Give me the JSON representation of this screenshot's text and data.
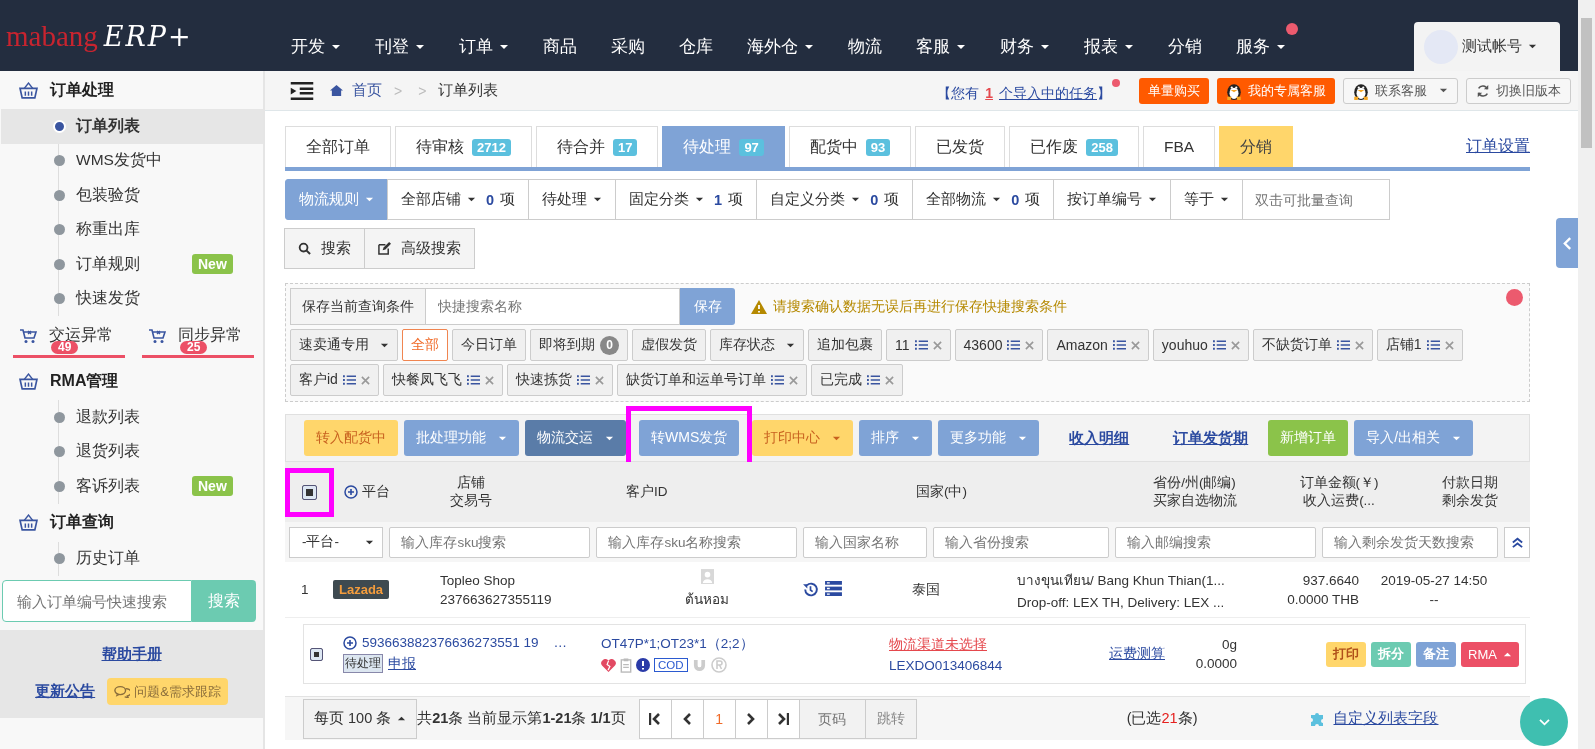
{
  "logo": {
    "brand": "mabang",
    "product": "ERP+"
  },
  "nav": [
    {
      "label": "开发",
      "dropdown": true,
      "dot": false
    },
    {
      "label": "刊登",
      "dropdown": true,
      "dot": false
    },
    {
      "label": "订单",
      "dropdown": true,
      "dot": false
    },
    {
      "label": "商品",
      "dropdown": false,
      "dot": false
    },
    {
      "label": "采购",
      "dropdown": false,
      "dot": false
    },
    {
      "label": "仓库",
      "dropdown": false,
      "dot": false
    },
    {
      "label": "海外仓",
      "dropdown": true,
      "dot": false
    },
    {
      "label": "物流",
      "dropdown": false,
      "dot": false
    },
    {
      "label": "客服",
      "dropdown": true,
      "dot": false
    },
    {
      "label": "财务",
      "dropdown": true,
      "dot": false
    },
    {
      "label": "报表",
      "dropdown": true,
      "dot": false
    },
    {
      "label": "分销",
      "dropdown": false,
      "dot": false
    },
    {
      "label": "服务",
      "dropdown": true,
      "dot": true
    }
  ],
  "account": {
    "name": "测试帐号"
  },
  "sidebar": {
    "sections": [
      {
        "title": "订单处理",
        "items": [
          {
            "label": "订单列表",
            "selected": true
          },
          {
            "label": "WMS发货中",
            "selected": false
          },
          {
            "label": "包装验货",
            "selected": false
          },
          {
            "label": "称重出库",
            "selected": false
          },
          {
            "label": "订单规则",
            "selected": false,
            "badge": "New"
          },
          {
            "label": "快速发货",
            "selected": false
          }
        ],
        "exceptions": [
          {
            "label": "交运异常",
            "count": "49"
          },
          {
            "label": "同步异常",
            "count": "25"
          }
        ]
      },
      {
        "title": "RMA管理",
        "items": [
          {
            "label": "退款列表",
            "selected": false
          },
          {
            "label": "退货列表",
            "selected": false
          },
          {
            "label": "客诉列表",
            "selected": false,
            "badge": "New"
          }
        ]
      },
      {
        "title": "订单查询",
        "items": [
          {
            "label": "历史订单",
            "selected": false
          }
        ]
      }
    ],
    "quick_search": {
      "placeholder": "输入订单编号快速搜索",
      "button": "搜索"
    },
    "help_link": "帮助手册",
    "update_link": "更新公告",
    "feedback_button": "问题&需求跟踪"
  },
  "breadcrumb": {
    "home": "首页",
    "separators": [
      ">",
      ">"
    ],
    "current": "订单列表"
  },
  "notice": {
    "prefix": "【您有",
    "count": "1",
    "link": "个导入中的任务",
    "suffix": "】",
    "dot": true
  },
  "header_buttons": [
    {
      "label": "单量购买",
      "kind": "orange"
    },
    {
      "label": "我的专属客服",
      "kind": "orange-penguin"
    },
    {
      "label": "联系客服",
      "kind": "penguin-dropdown"
    },
    {
      "label": "切换旧版本",
      "kind": "refresh"
    }
  ],
  "tabs": [
    {
      "label": "全部订单",
      "selected": false,
      "kind": "normal"
    },
    {
      "label": "待审核",
      "count": "2712",
      "selected": false,
      "kind": "normal"
    },
    {
      "label": "待合并",
      "count": "17",
      "selected": false,
      "kind": "normal"
    },
    {
      "label": "待处理",
      "count": "97",
      "selected": true,
      "kind": "normal"
    },
    {
      "label": "配货中",
      "count": "93",
      "selected": false,
      "kind": "normal"
    },
    {
      "label": "已发货",
      "selected": false,
      "kind": "normal"
    },
    {
      "label": "已作废",
      "count": "258",
      "selected": false,
      "kind": "normal"
    },
    {
      "label": "FBA",
      "selected": false,
      "kind": "normal"
    },
    {
      "label": "分销",
      "selected": false,
      "kind": "highlight"
    }
  ],
  "order_settings_link": "订单设置",
  "filters": [
    {
      "label": "物流规则",
      "kind": "primary"
    },
    {
      "label": "全部店铺",
      "count": "0",
      "unit": "项",
      "kind": "dropdown"
    },
    {
      "label": "待处理",
      "kind": "dropdown"
    },
    {
      "label": "固定分类",
      "count": "1",
      "unit": "项",
      "kind": "dropdown"
    },
    {
      "label": "自定义分类",
      "count": "0",
      "unit": "项",
      "kind": "dropdown"
    },
    {
      "label": "全部物流",
      "count": "0",
      "unit": "项",
      "kind": "dropdown"
    },
    {
      "label": "按订单编号",
      "kind": "dropdown"
    },
    {
      "label": "等于",
      "kind": "dropdown"
    },
    {
      "placeholder": "双击可批量查询",
      "kind": "input"
    }
  ],
  "search_buttons": [
    {
      "label": "搜索",
      "kind": "search"
    },
    {
      "label": "高级搜索",
      "kind": "edit"
    }
  ],
  "saved_search": {
    "label": "保存当前查询条件",
    "placeholder": "快捷搜索名称",
    "button": "保存",
    "warning": "请搜索确认数据无误后再进行保存快捷搜索条件"
  },
  "quick_tags": [
    {
      "label": "速卖通专用",
      "kind": "dropdown",
      "selected": false
    },
    {
      "label": "全部",
      "kind": "plain",
      "selected": true
    },
    {
      "label": "今日订单",
      "kind": "plain",
      "selected": false
    },
    {
      "label": "即将到期",
      "kind": "count",
      "count": "0",
      "selected": false
    },
    {
      "label": "虚假发货",
      "kind": "plain",
      "selected": false
    },
    {
      "label": "库存状态",
      "kind": "dropdown",
      "selected": false
    },
    {
      "label": "追加包裹",
      "kind": "plain",
      "selected": false
    },
    {
      "label": "11",
      "kind": "saved",
      "selected": false
    },
    {
      "label": "43600",
      "kind": "saved",
      "selected": false
    },
    {
      "label": "Amazon",
      "kind": "saved",
      "selected": false
    },
    {
      "label": "youhuo",
      "kind": "saved",
      "selected": false
    },
    {
      "label": "不缺货订单",
      "kind": "saved",
      "selected": false
    },
    {
      "label": "店铺1",
      "kind": "saved",
      "selected": false
    },
    {
      "label": "客户id",
      "kind": "saved",
      "selected": false
    },
    {
      "label": "快餐凤飞飞",
      "kind": "saved",
      "selected": false
    },
    {
      "label": "快速拣货",
      "kind": "saved",
      "selected": false
    },
    {
      "label": "缺货订单和运单号订单",
      "kind": "saved",
      "selected": false
    },
    {
      "label": "已完成",
      "kind": "saved",
      "selected": false
    }
  ],
  "toolbar": [
    {
      "label": "转入配货中",
      "kind": "yellow",
      "dropdown": false,
      "highlighted": false
    },
    {
      "label": "批处理功能",
      "kind": "blue",
      "dropdown": true,
      "highlighted": false
    },
    {
      "label": "物流交运",
      "kind": "dark",
      "dropdown": true,
      "highlighted": false
    },
    {
      "label": "转WMS发货",
      "kind": "blue",
      "dropdown": false,
      "highlighted": true
    },
    {
      "label": "打印中心",
      "kind": "yellow",
      "dropdown": true,
      "highlighted": false
    },
    {
      "label": "排序",
      "kind": "blue",
      "dropdown": true,
      "highlighted": false
    },
    {
      "label": "更多功能",
      "kind": "blue",
      "dropdown": true,
      "highlighted": false
    },
    {
      "label": "收入明细",
      "kind": "link",
      "dropdown": false,
      "highlighted": false
    },
    {
      "label": "订单发货期",
      "kind": "link",
      "dropdown": false,
      "highlighted": false
    },
    {
      "label": "新增订单",
      "kind": "green",
      "dropdown": false,
      "highlighted": false
    },
    {
      "label": "导入/出相关",
      "kind": "blue",
      "dropdown": true,
      "highlighted": false
    }
  ],
  "table": {
    "select_all": {
      "checked": true,
      "highlighted": true
    },
    "columns": [
      {
        "lines": [
          "平台"
        ],
        "kind": "platform"
      },
      {
        "lines": [
          "店铺",
          "交易号"
        ]
      },
      {
        "lines": [
          "客户ID"
        ]
      },
      {
        "lines": [
          "国家(中)"
        ]
      },
      {
        "lines": [
          "省份/州(邮编)",
          "买家自选物流"
        ]
      },
      {
        "lines": [
          "订单金额(￥)",
          "收入运费(..."
        ]
      },
      {
        "lines": [
          "付款日期",
          "剩余发货"
        ]
      }
    ],
    "column_filters": [
      {
        "kind": "select",
        "value": "-平台-"
      },
      {
        "kind": "input",
        "placeholder": "输入库存sku搜索"
      },
      {
        "kind": "input",
        "placeholder": "输入库存sku名称搜索"
      },
      {
        "kind": "input",
        "placeholder": "输入国家名称"
      },
      {
        "kind": "input",
        "placeholder": "输入省份搜索"
      },
      {
        "kind": "input",
        "placeholder": "输入邮编搜索"
      },
      {
        "kind": "input",
        "placeholder": "输入剩余发货天数搜索"
      }
    ],
    "rows": [
      {
        "index": "1",
        "platform": "Lazada",
        "shop": "Topleo Shop",
        "trade_no": "237663627355119",
        "customer": "ต้นหอม",
        "country": "泰国",
        "region": "บางขุนเทียน/ Bang Khun Thian(1...",
        "buyer_logistics": "Drop-off: LEX TH, Delivery: LEX ...",
        "amount": "937.6640",
        "freight": "0.0000 THB",
        "paid_date": "2019-05-27 14:50",
        "remaining": "--",
        "detail": {
          "checked": true,
          "order_no": "593663882376636273551 19",
          "ellipsis": "…",
          "status": "待处理",
          "declare_link": "申报",
          "sku": "OT47P*1;OT23*1（2;2）",
          "cod": "COD",
          "logistics_warning": "物流渠道未选择",
          "tracking_no": "LEXDO013406844",
          "freight_link": "运费测算",
          "weight": "0g",
          "cost": "0.0000",
          "actions": [
            {
              "label": "打印",
              "kind": "yellow"
            },
            {
              "label": "拆分",
              "kind": "teal"
            },
            {
              "label": "备注",
              "kind": "blue"
            },
            {
              "label": "RMA",
              "kind": "red"
            }
          ]
        }
      }
    ]
  },
  "pagination": {
    "page_size": "每页 100 条",
    "summary": "共**21**条 当前显示第**1-21**条 **1/1**页",
    "current_page": "1",
    "page_placeholder": "页码",
    "jump": "跳转",
    "selected_prefix": "(已选",
    "selected_count": "21",
    "selected_suffix": "条)",
    "customize_link": "自定义列表字段"
  }
}
